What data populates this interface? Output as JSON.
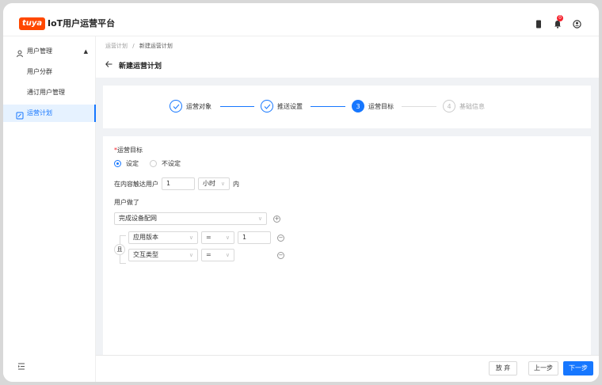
{
  "header": {
    "logo_text": "tuya",
    "title": "IoT用户运营平台",
    "notification_count": "0"
  },
  "sidebar": {
    "items": [
      {
        "label": "用户管理",
        "icon": "user-icon"
      },
      {
        "label": "用户分群"
      },
      {
        "label": "通订用户管理"
      },
      {
        "label": "运营计划",
        "icon": "plan-icon"
      }
    ]
  },
  "breadcrumb": {
    "parent": "运营计划",
    "separator": "/",
    "current": "新建运营计划"
  },
  "page": {
    "title": "新建运营计划"
  },
  "steps": [
    {
      "index": "1",
      "label": "运营对象",
      "state": "done"
    },
    {
      "index": "2",
      "label": "推送设置",
      "state": "done"
    },
    {
      "index": "3",
      "label": "运营目标",
      "state": "active"
    },
    {
      "index": "4",
      "label": "基础信息",
      "state": "pending"
    }
  ],
  "form": {
    "goal_label": "运营目标",
    "radio_set": "设定",
    "radio_unset": "不设定",
    "reach_prefix": "在内容触达用户",
    "reach_value": "1",
    "reach_unit": "小时",
    "reach_suffix": "内",
    "did_label": "用户做了",
    "event_select": "完成设备配网",
    "and_label": "且",
    "cond1": {
      "field": "应用版本",
      "op": "=",
      "value": "1"
    },
    "cond2": {
      "field": "交互类型",
      "op": "="
    }
  },
  "footer": {
    "discard": "放 弃",
    "prev": "上一步",
    "next": "下一步"
  },
  "colors": {
    "primary": "#1677ff",
    "brand": "#ff4800"
  }
}
